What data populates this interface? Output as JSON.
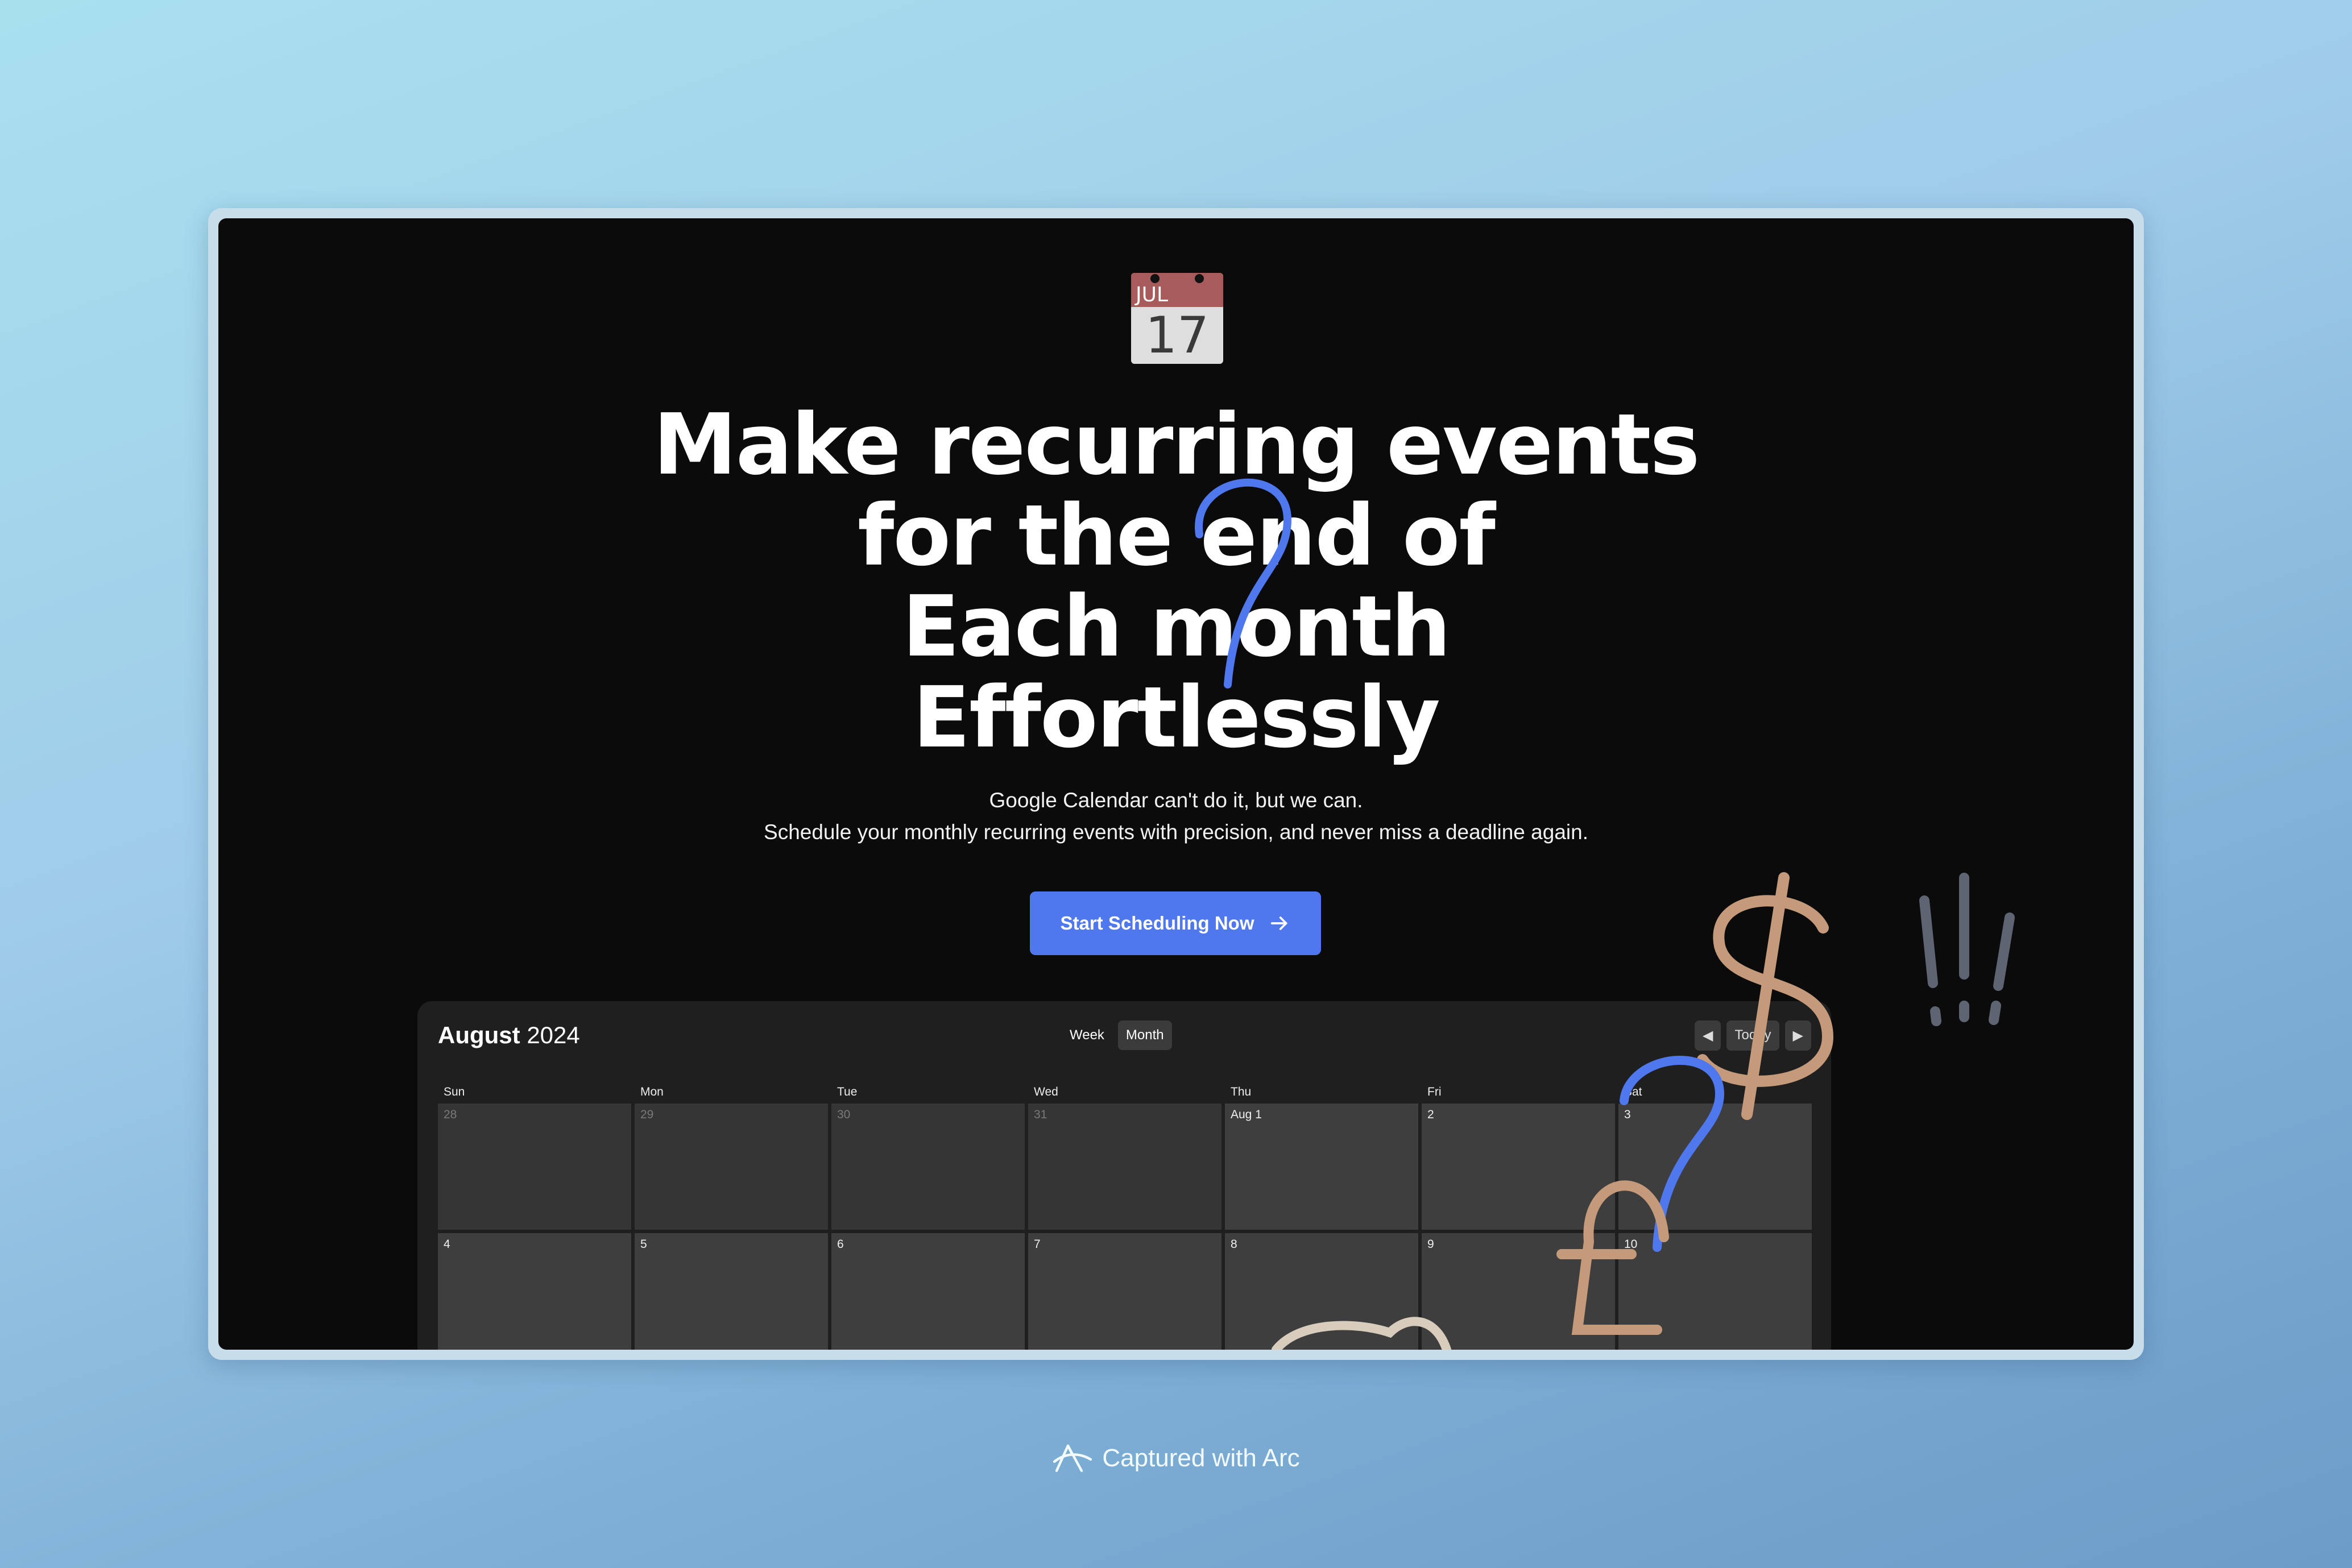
{
  "hero": {
    "calendar_icon": {
      "month": "JUL",
      "day": "17"
    },
    "headline": [
      "Make recurring events",
      "for the end of",
      "Each month",
      "Effortlessly"
    ],
    "subtitle": [
      "Google Calendar can't do it, but we can.",
      "Schedule your monthly recurring events with precision, and never miss a deadline again."
    ],
    "cta_label": "Start Scheduling Now"
  },
  "calendar": {
    "month": "August",
    "year": "2024",
    "views": [
      "Week",
      "Month"
    ],
    "active_view": "Month",
    "nav": {
      "prev": "◀",
      "today": "Today",
      "next": "▶"
    },
    "weekdays": [
      "Sun",
      "Mon",
      "Tue",
      "Wed",
      "Thu",
      "Fri",
      "Sat"
    ],
    "week1": [
      "28",
      "29",
      "30",
      "31",
      "Aug 1",
      "2",
      "3"
    ],
    "week2": [
      "4",
      "5",
      "6",
      "7",
      "8",
      "9",
      "10"
    ]
  },
  "doodle_colors": {
    "accent_blue": "#4f78ee",
    "tan": "#c59a7a",
    "grey": "#5f6472"
  },
  "footer": {
    "label": "Captured with Arc"
  }
}
